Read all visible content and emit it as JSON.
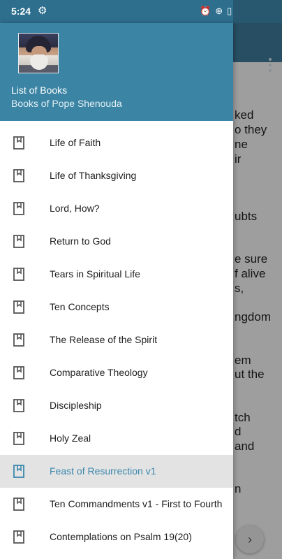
{
  "status_bar": {
    "time": "5:24"
  },
  "colors": {
    "accent": "#3b84a4",
    "active_text": "#3b88ad",
    "active_bg": "#e3e3e3",
    "icon": "#555555"
  },
  "drawer": {
    "header": {
      "title": "List of Books",
      "subtitle": "Books of Pope Shenouda"
    },
    "items": [
      {
        "label": "Life of Faith",
        "icon": "book-icon",
        "active": false
      },
      {
        "label": "Life of Thanksgiving",
        "icon": "book-icon",
        "active": false
      },
      {
        "label": "Lord, How?",
        "icon": "book-icon",
        "active": false
      },
      {
        "label": "Return to God",
        "icon": "book-icon",
        "active": false
      },
      {
        "label": "Tears in Spiritual Life",
        "icon": "book-icon",
        "active": false
      },
      {
        "label": "Ten Concepts",
        "icon": "book-icon",
        "active": false
      },
      {
        "label": "The Release of the Spirit",
        "icon": "book-icon",
        "active": false
      },
      {
        "label": "Comparative Theology",
        "icon": "book-icon",
        "active": false
      },
      {
        "label": "Discipleship",
        "icon": "book-icon",
        "active": false
      },
      {
        "label": "Holy Zeal",
        "icon": "book-icon",
        "active": false
      },
      {
        "label": "Feast of Resurrection v1",
        "icon": "book-icon",
        "active": true
      },
      {
        "label": "Ten Commandments v1 - First to Fourth",
        "icon": "book-icon",
        "active": false
      },
      {
        "label": "Contemplations on Psalm 19(20)",
        "icon": "book-icon",
        "active": false
      }
    ]
  },
  "background_text": [
    "ked",
    "o they",
    "ne",
    "ir",
    "ubts",
    "e sure",
    "f alive",
    "s,",
    "ngdom",
    "em",
    "ut the",
    "tch",
    "d",
    "and",
    "n"
  ]
}
